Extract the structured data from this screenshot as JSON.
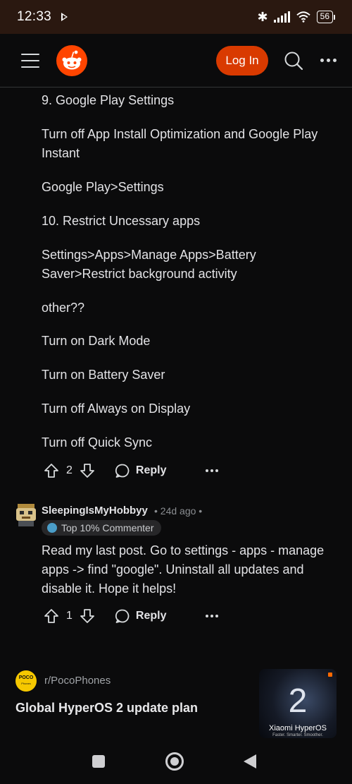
{
  "status_bar": {
    "time": "12:33",
    "battery": "56",
    "icons": [
      "play-icon",
      "bluetooth-icon",
      "signal-icon",
      "wifi-icon",
      "battery-icon"
    ]
  },
  "header": {
    "login_label": "Log In",
    "brand_color": "#d93a00",
    "icons": [
      "menu-icon",
      "reddit-logo-icon",
      "search-icon",
      "more-icon"
    ]
  },
  "comment1": {
    "paragraphs": [
      "9. Google Play Settings",
      "Turn off App Install Optimization and Google Play Instant",
      "Google Play>Settings",
      "10. Restrict Uncessary apps",
      "Settings>Apps>Manage Apps>Battery Saver>Restrict background activity",
      "other??",
      "Turn on Dark Mode",
      "Turn on Battery Saver",
      "Turn off Always on Display",
      "Turn off Quick Sync"
    ],
    "votes": "2",
    "reply_label": "Reply"
  },
  "comment2": {
    "author": "SleepingIsMyHobbyy",
    "meta": "• 24d ago •",
    "badge": "Top 10% Commenter",
    "body": "Read my last post. Go to settings - apps - manage apps -> find \"google\". Uninstall all updates and disable it. Hope it helps!",
    "votes": "1",
    "reply_label": "Reply"
  },
  "post_card": {
    "subreddit": "r/PocoPhones",
    "avatar_text": "POCO",
    "avatar_subtext": "Phones",
    "title": "Global HyperOS 2 update plan",
    "thumbnail": {
      "number": "2",
      "brand": "Xiaomi HyperOS",
      "tagline": "Faster. Smarter. Smoother."
    }
  },
  "nav_bar": {
    "icons": [
      "recents-square-icon",
      "home-circle-icon",
      "back-triangle-icon"
    ]
  }
}
